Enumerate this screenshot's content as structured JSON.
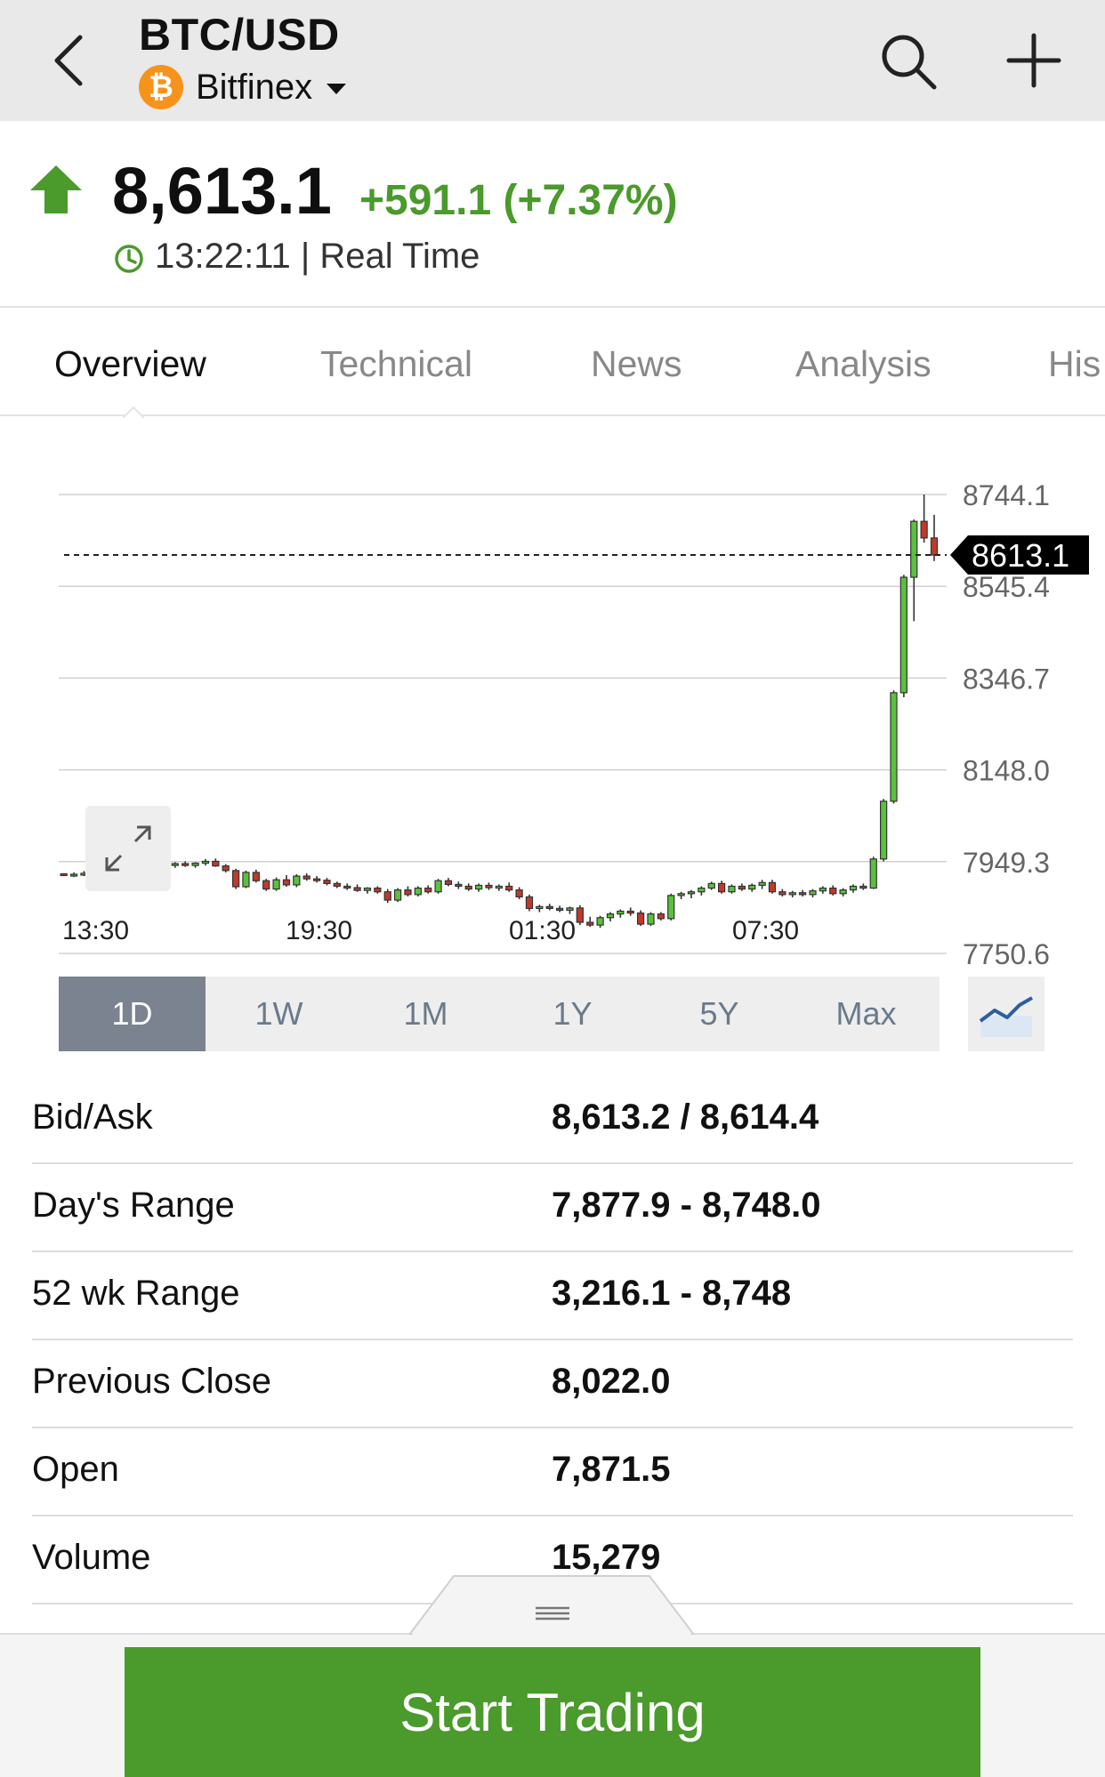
{
  "header": {
    "pair": "BTC/USD",
    "exchange": "Bitfinex",
    "coin_symbol": "₿",
    "icons": [
      "back-icon",
      "search-icon",
      "plus-icon",
      "chevron-down-icon"
    ]
  },
  "quote": {
    "price": "8,613.1",
    "change": "+591.1 (+7.37%)",
    "time_status": "13:22:11 | Real Time"
  },
  "tabs": [
    {
      "label": "Overview",
      "active": true
    },
    {
      "label": "Technical",
      "active": false
    },
    {
      "label": "News",
      "active": false
    },
    {
      "label": "Analysis",
      "active": false
    },
    {
      "label": "His",
      "active": false
    }
  ],
  "chart_data": {
    "type": "candlestick",
    "y_ticks": [
      "8744.1",
      "8545.4",
      "8346.7",
      "8148.0",
      "7949.3",
      "7750.6"
    ],
    "ylim": [
      7750.6,
      8744.1
    ],
    "x_ticks": [
      "13:30",
      "19:30",
      "01:30",
      "07:30"
    ],
    "current_price_label": "8613.1",
    "current_price": 8613.1,
    "up_color": "#58c23b",
    "down_color": "#c0392b",
    "candles": [
      [
        7923,
        7924,
        7918,
        7921
      ],
      [
        7921,
        7926,
        7916,
        7922
      ],
      [
        7922,
        7929,
        7918,
        7924
      ],
      [
        7924,
        7960,
        7922,
        7957
      ],
      [
        7957,
        7963,
        7950,
        7953
      ],
      [
        7953,
        7962,
        7948,
        7959
      ],
      [
        7959,
        7964,
        7952,
        7955
      ],
      [
        7955,
        7958,
        7944,
        7948
      ],
      [
        7948,
        7953,
        7940,
        7944
      ],
      [
        7944,
        7950,
        7938,
        7947
      ],
      [
        7947,
        7952,
        7940,
        7943
      ],
      [
        7943,
        7948,
        7936,
        7945
      ],
      [
        7945,
        7950,
        7938,
        7941
      ],
      [
        7941,
        7948,
        7936,
        7946
      ],
      [
        7946,
        7955,
        7941,
        7950
      ],
      [
        7950,
        7956,
        7938,
        7940
      ],
      [
        7940,
        7944,
        7926,
        7930
      ],
      [
        7930,
        7934,
        7890,
        7895
      ],
      [
        7895,
        7930,
        7892,
        7926
      ],
      [
        7926,
        7932,
        7904,
        7908
      ],
      [
        7908,
        7912,
        7886,
        7890
      ],
      [
        7890,
        7915,
        7886,
        7910
      ],
      [
        7910,
        7920,
        7895,
        7899
      ],
      [
        7899,
        7922,
        7894,
        7918
      ],
      [
        7918,
        7924,
        7908,
        7912
      ],
      [
        7912,
        7918,
        7904,
        7909
      ],
      [
        7909,
        7914,
        7898,
        7902
      ],
      [
        7902,
        7906,
        7892,
        7896
      ],
      [
        7896,
        7902,
        7888,
        7893
      ],
      [
        7893,
        7900,
        7884,
        7887
      ],
      [
        7887,
        7894,
        7880,
        7892
      ],
      [
        7892,
        7896,
        7880,
        7884
      ],
      [
        7884,
        7890,
        7860,
        7866
      ],
      [
        7866,
        7892,
        7862,
        7888
      ],
      [
        7888,
        7896,
        7874,
        7878
      ],
      [
        7878,
        7896,
        7874,
        7892
      ],
      [
        7892,
        7898,
        7880,
        7884
      ],
      [
        7884,
        7912,
        7880,
        7908
      ],
      [
        7908,
        7914,
        7896,
        7900
      ],
      [
        7900,
        7906,
        7890,
        7896
      ],
      [
        7896,
        7902,
        7886,
        7890
      ],
      [
        7890,
        7902,
        7884,
        7898
      ],
      [
        7898,
        7904,
        7888,
        7893
      ],
      [
        7893,
        7900,
        7886,
        7896
      ],
      [
        7896,
        7904,
        7884,
        7888
      ],
      [
        7888,
        7894,
        7868,
        7873
      ],
      [
        7873,
        7878,
        7842,
        7848
      ],
      [
        7848,
        7856,
        7840,
        7852
      ],
      [
        7852,
        7858,
        7844,
        7848
      ],
      [
        7848,
        7854,
        7840,
        7844
      ],
      [
        7844,
        7852,
        7836,
        7849
      ],
      [
        7849,
        7855,
        7812,
        7818
      ],
      [
        7818,
        7830,
        7808,
        7812
      ],
      [
        7812,
        7832,
        7806,
        7828
      ],
      [
        7828,
        7840,
        7820,
        7836
      ],
      [
        7836,
        7846,
        7828,
        7842
      ],
      [
        7842,
        7850,
        7832,
        7838
      ],
      [
        7838,
        7844,
        7810,
        7814
      ],
      [
        7814,
        7840,
        7810,
        7836
      ],
      [
        7836,
        7840,
        7822,
        7826
      ],
      [
        7826,
        7880,
        7822,
        7876
      ],
      [
        7876,
        7884,
        7868,
        7880
      ],
      [
        7880,
        7888,
        7870,
        7884
      ],
      [
        7884,
        7896,
        7876,
        7892
      ],
      [
        7892,
        7906,
        7888,
        7902
      ],
      [
        7902,
        7908,
        7880,
        7884
      ],
      [
        7884,
        7900,
        7880,
        7896
      ],
      [
        7896,
        7902,
        7886,
        7890
      ],
      [
        7890,
        7902,
        7884,
        7898
      ],
      [
        7898,
        7910,
        7890,
        7904
      ],
      [
        7904,
        7910,
        7880,
        7884
      ],
      [
        7884,
        7890,
        7874,
        7878
      ],
      [
        7878,
        7886,
        7872,
        7882
      ],
      [
        7882,
        7888,
        7874,
        7878
      ],
      [
        7878,
        7890,
        7872,
        7886
      ],
      [
        7886,
        7896,
        7880,
        7892
      ],
      [
        7892,
        7898,
        7876,
        7880
      ],
      [
        7880,
        7892,
        7874,
        7888
      ],
      [
        7888,
        7900,
        7882,
        7896
      ],
      [
        7896,
        7902,
        7888,
        7892
      ],
      [
        7892,
        7960,
        7890,
        7955
      ],
      [
        7955,
        8085,
        7950,
        8080
      ],
      [
        8080,
        8320,
        8075,
        8315
      ],
      [
        8315,
        8570,
        8305,
        8565
      ],
      [
        8565,
        8690,
        8470,
        8686
      ],
      [
        8686,
        8744,
        8640,
        8650
      ],
      [
        8650,
        8700,
        8600,
        8613
      ]
    ]
  },
  "ranges": [
    {
      "label": "1D",
      "active": true
    },
    {
      "label": "1W",
      "active": false
    },
    {
      "label": "1M",
      "active": false
    },
    {
      "label": "1Y",
      "active": false
    },
    {
      "label": "5Y",
      "active": false
    },
    {
      "label": "Max",
      "active": false
    }
  ],
  "stats": [
    {
      "label": "Bid/Ask",
      "value": "8,613.2 / 8,614.4"
    },
    {
      "label": "Day's Range",
      "value": "7,877.9 - 8,748.0"
    },
    {
      "label": "52 wk Range",
      "value": "3,216.1 - 8,748"
    },
    {
      "label": "Previous Close",
      "value": "8,022.0"
    },
    {
      "label": "Open",
      "value": "7,871.5"
    },
    {
      "label": "Volume",
      "value": "15,279"
    }
  ],
  "cta": {
    "label": "Start Trading",
    "color": "#4a9a2c"
  }
}
